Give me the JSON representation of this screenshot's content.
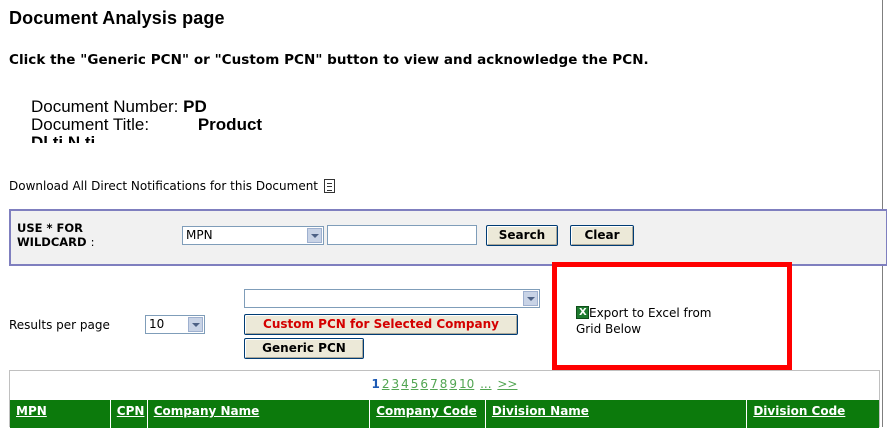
{
  "page": {
    "title": "Document Analysis page",
    "instructions": "Click the \"Generic PCN\" or \"Custom PCN\" button to view and acknowledge the PCN."
  },
  "document": {
    "number_label": "Document Number:",
    "number_value": "PD",
    "title_label": "Document Title:",
    "title_value": "Product",
    "clipped_text": "Dl  ti              N ti"
  },
  "download_link": "Download All Direct Notifications for this Document",
  "search": {
    "wildcard_label_line1": "USE * FOR",
    "wildcard_label_line2": "WILDCARD",
    "wildcard_colon": ":",
    "field_selected": "MPN",
    "input_value": "",
    "search_button": "Search",
    "clear_button": "Clear"
  },
  "results": {
    "per_page_label": "Results per page",
    "per_page_value": "10",
    "company_select_value": "",
    "custom_pcn_button": "Custom PCN for Selected Company",
    "generic_pcn_button": "Generic PCN",
    "export_label_line1": "Export to Excel from",
    "export_label_line2": "Grid Below"
  },
  "pager": {
    "current": "1",
    "pages": [
      "2",
      "3",
      "4",
      "5",
      "6",
      "7",
      "8",
      "9",
      "10",
      "...",
      ">>"
    ]
  },
  "grid_columns": [
    "MPN",
    "CPN",
    "Company Name",
    "Company Code",
    "Division Name",
    "Division Code"
  ],
  "colors": {
    "header_green": "#0c7a0c",
    "highlight_red": "#ff0000",
    "custom_button_text": "#d40000"
  },
  "icons": {
    "download": "document-icon",
    "export": "excel-icon"
  }
}
